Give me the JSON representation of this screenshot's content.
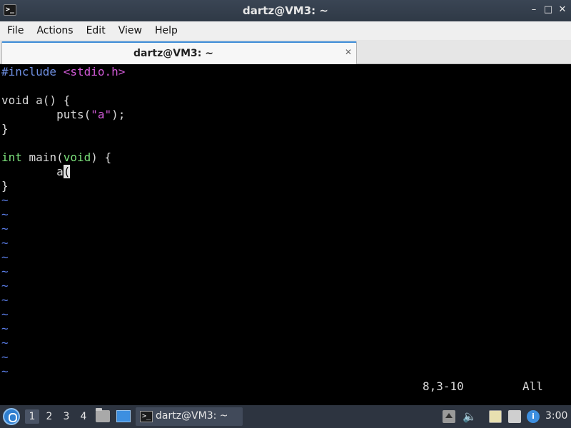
{
  "window": {
    "title": "dartz@VM3: ~",
    "app_icon": "terminal-icon",
    "minimize": "–",
    "maximize": "□",
    "close": "✕"
  },
  "menu": {
    "file": "File",
    "actions": "Actions",
    "edit": "Edit",
    "view": "View",
    "help": "Help"
  },
  "tab": {
    "label": "dartz@VM3: ~",
    "close": "✕"
  },
  "editor": {
    "l1_pre": "#include ",
    "l1_str": "<stdio.h>",
    "l3": "void a() {",
    "l4_a": "        puts(",
    "l4_str": "\"a\"",
    "l4_b": ");",
    "l5": "}",
    "l7_type": "int",
    "l7_a": " main(",
    "l7_type2": "void",
    "l7_b": ") {",
    "l8_a": "        a",
    "l8_cursor": "(",
    "l9": "}",
    "tilde": "~",
    "status_position": "8,3-10",
    "status_scroll": "All"
  },
  "taskbar": {
    "start_icon": "lubuntu-menu-icon",
    "workspaces": [
      "1",
      "2",
      "3",
      "4"
    ],
    "active_workspace": "1",
    "task_label": "dartz@VM3: ~",
    "volume_glyph": "🔈",
    "notify_glyph": "i",
    "clock": "3:00"
  }
}
